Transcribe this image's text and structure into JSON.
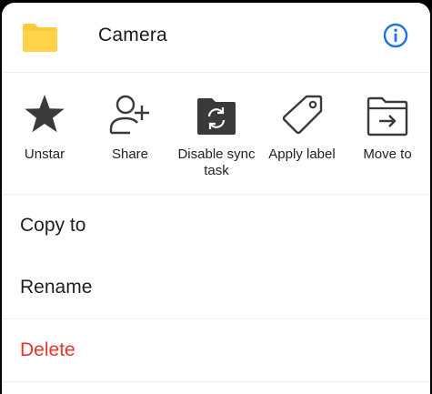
{
  "header": {
    "title": "Camera",
    "folder_icon": "folder-icon",
    "info_icon": "info-icon",
    "folder_color": "#ffc83d",
    "accent_color": "#1a73e8"
  },
  "actions": [
    {
      "label": "Unstar",
      "icon": "star-icon"
    },
    {
      "label": "Share",
      "icon": "add-person-icon"
    },
    {
      "label": "Disable sync task",
      "icon": "sync-folder-icon"
    },
    {
      "label": "Apply label",
      "icon": "tag-icon"
    },
    {
      "label": "Move to",
      "icon": "move-folder-icon"
    }
  ],
  "menu": {
    "copy_to": "Copy to",
    "rename": "Rename",
    "delete": "Delete",
    "delete_color": "#e5352b"
  }
}
